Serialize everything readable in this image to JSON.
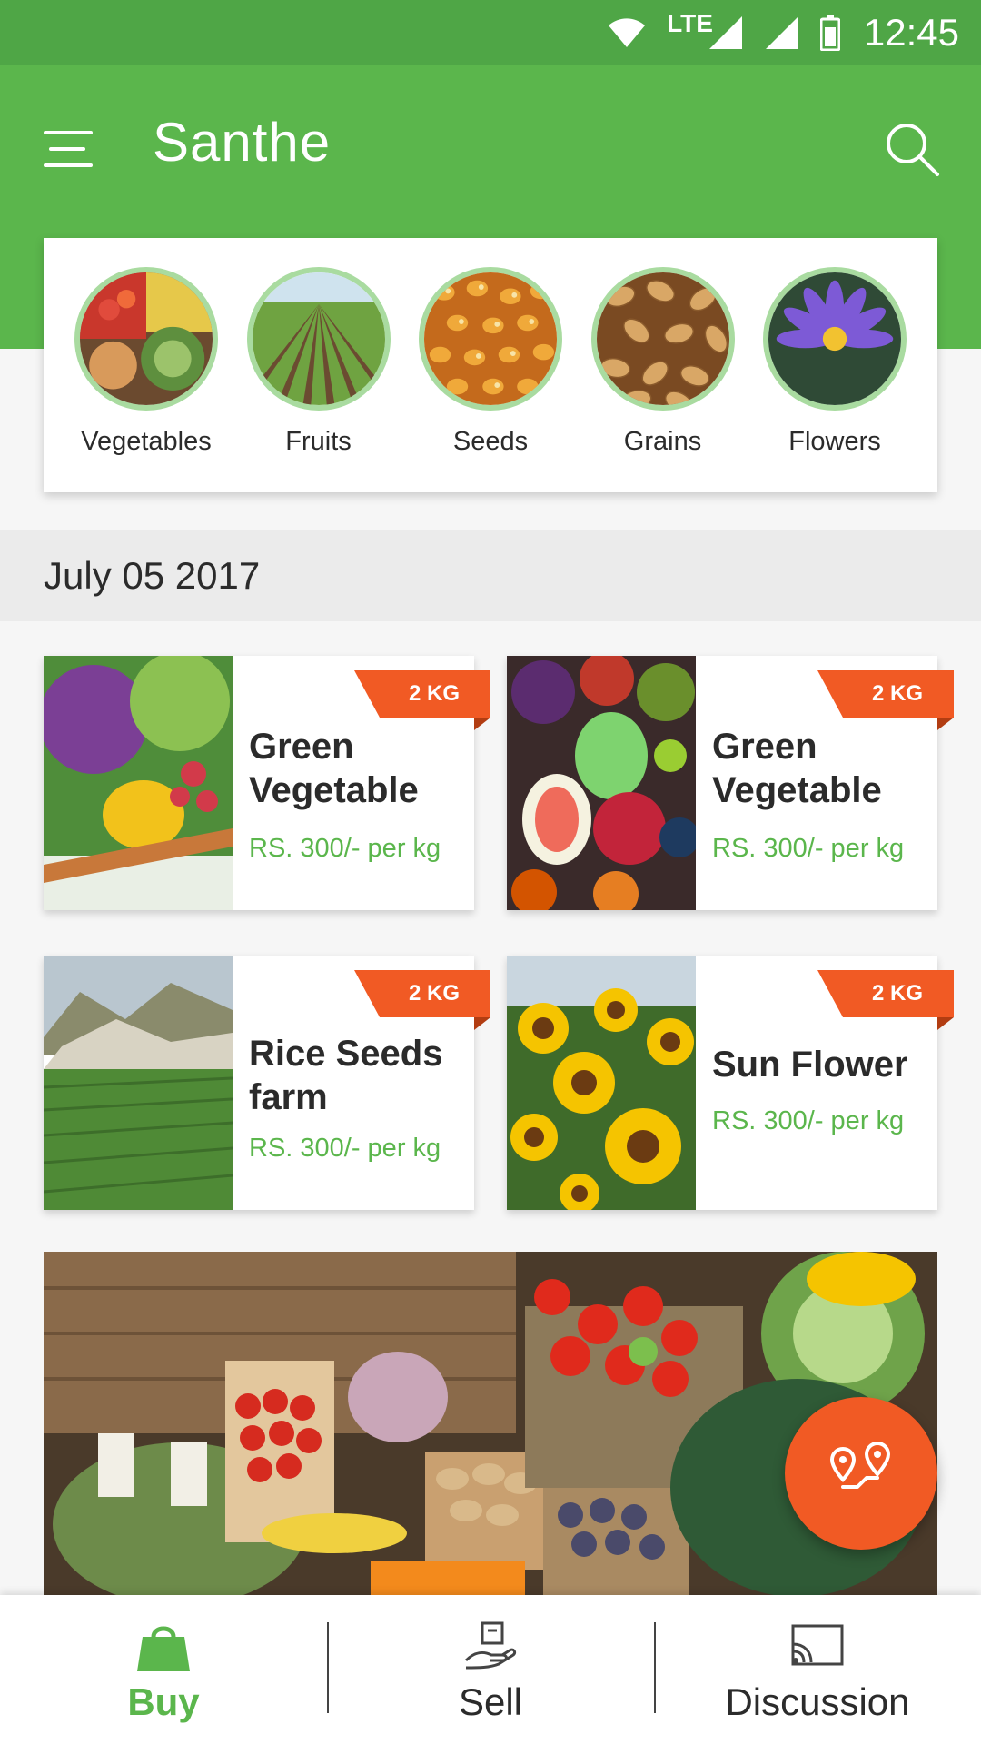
{
  "status_bar": {
    "network": "LTE",
    "time": "12:45"
  },
  "app": {
    "title": "Santhe"
  },
  "categories": [
    {
      "label": "Vegetables",
      "icon": "vegetables-photo"
    },
    {
      "label": "Fruits",
      "icon": "field-photo"
    },
    {
      "label": "Seeds",
      "icon": "seeds-photo"
    },
    {
      "label": "Grains",
      "icon": "grains-photo"
    },
    {
      "label": "Flowers",
      "icon": "flower-photo"
    }
  ],
  "date_header": "July 05 2017",
  "products": [
    {
      "name_line1": "Green",
      "name_line2": "Vegetable",
      "price": "RS. 300/- per kg",
      "badge": "2 KG"
    },
    {
      "name_line1": "Green",
      "name_line2": "Vegetable",
      "price": "RS. 300/- per kg",
      "badge": "2 KG"
    },
    {
      "name_line1": "Rice Seeds",
      "name_line2": "farm",
      "price": "RS. 300/- per kg",
      "badge": "2 KG"
    },
    {
      "name_line1": "Sun Flower",
      "name_line2": "",
      "price": "RS. 300/- per kg",
      "badge": "2 KG"
    }
  ],
  "fab": {
    "icon": "route-pins-icon"
  },
  "bottom_nav": [
    {
      "label": "Buy",
      "icon": "shopping-bag-icon",
      "active": true
    },
    {
      "label": "Sell",
      "icon": "hand-box-icon",
      "active": false
    },
    {
      "label": "Discussion",
      "icon": "cast-icon",
      "active": false
    }
  ],
  "colors": {
    "primary": "#5bb64c",
    "status_bar": "#4fa646",
    "accent": "#f15a24",
    "category_ring": "#a9dba0",
    "date_band": "#ebebeb"
  }
}
